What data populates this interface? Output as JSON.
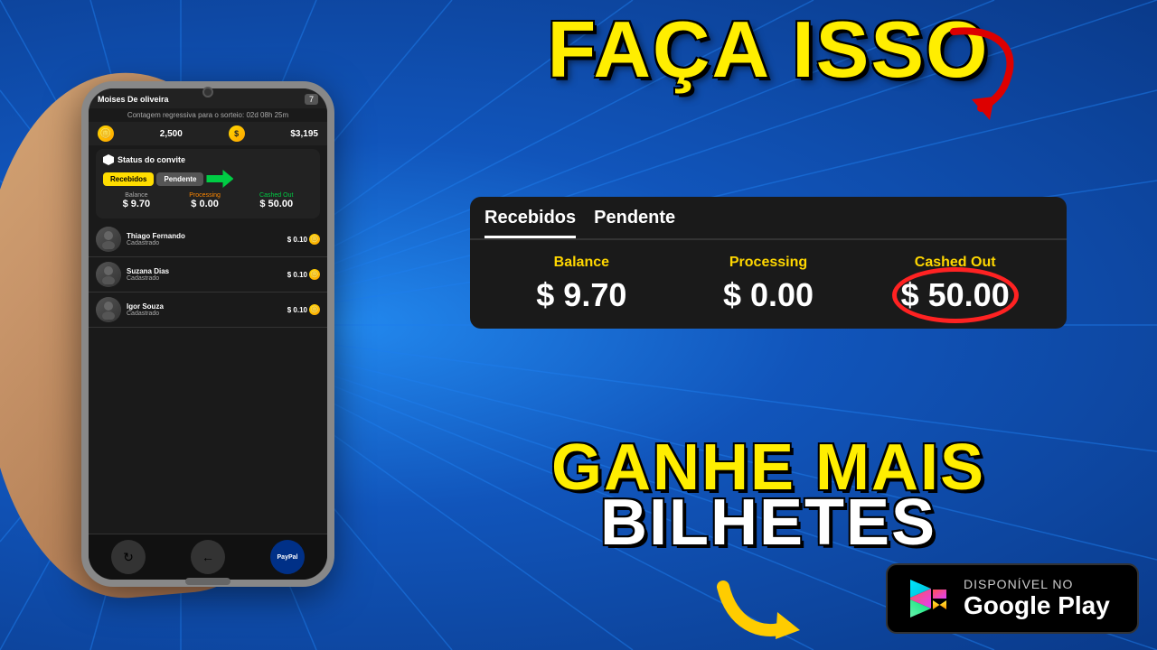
{
  "background": {
    "color": "#1a6fd4"
  },
  "phone": {
    "user_name": "Moises De oliveira",
    "level": "7",
    "countdown_label": "Contagem regressiva para o sorteio:",
    "countdown_value": "02d 08h 25m",
    "coin_amount": "2,500",
    "dollar_amount": "$3,195",
    "invite_status_title": "Status do convite",
    "tab_recebidos": "Recebidos",
    "tab_pendente": "Pendente",
    "balance_label": "Balance",
    "processing_label": "Processing",
    "cashed_out_label": "Cashed Out",
    "balance_value": "$ 9.70",
    "processing_value": "$ 0.00",
    "cashed_out_value": "$ 50.00",
    "contacts": [
      {
        "name": "Thiago Fernando",
        "status": "Cadastrado",
        "reward": "$ 0.10"
      },
      {
        "name": "Suzana Dias",
        "status": "Cadastrado",
        "reward": "$ 0.10"
      },
      {
        "name": "Igor Souza",
        "status": "Cadastrado",
        "reward": "$ 0.10"
      }
    ]
  },
  "headline_top": "FAÇA ISSO",
  "app_panel": {
    "tab_recebidos": "Recebidos",
    "tab_pendente": "Pendente",
    "balance_label": "Balance",
    "processing_label": "Processing",
    "cashed_out_label": "Cashed Out",
    "balance_value": "$ 9.70",
    "processing_value": "$ 0.00",
    "cashed_out_value": "$ 50.00"
  },
  "headline_bottom_line1": "GANHE MAIS",
  "headline_bottom_line2": "BILHETES",
  "google_play": {
    "disponivel": "DISPONÍVEL NO",
    "name": "Google Play"
  }
}
